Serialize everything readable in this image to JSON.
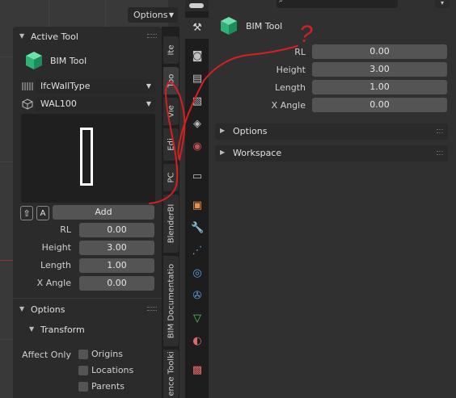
{
  "viewport": {
    "options_label": "Options"
  },
  "npanel": {
    "active_tool": {
      "header": "Active Tool",
      "tool_name": "BIM Tool",
      "type_dropdown": "IfcWallType",
      "element_dropdown": "WAL100",
      "add_label": "Add",
      "add_arrow_glyph": "⇧",
      "add_a_glyph": "A",
      "fields": [
        {
          "label": "RL",
          "value": "0.00"
        },
        {
          "label": "Height",
          "value": "3.00"
        },
        {
          "label": "Length",
          "value": "1.00"
        },
        {
          "label": "X Angle",
          "value": "0.00"
        }
      ]
    },
    "options": {
      "header": "Options",
      "transform_header": "Transform",
      "affect_only_label": "Affect Only",
      "checkboxes": [
        "Origins",
        "Locations",
        "Parents"
      ]
    }
  },
  "tabs": [
    {
      "label": "Ite",
      "active": false
    },
    {
      "label": "Too",
      "active": true
    },
    {
      "label": "Vie",
      "active": false
    },
    {
      "label": "Edi",
      "active": false
    },
    {
      "label": "PC",
      "active": false
    },
    {
      "label": "BlenderBI",
      "active": false
    },
    {
      "label": "BIM Documentatio",
      "active": false
    },
    {
      "label": "ence Toolki",
      "active": false
    }
  ],
  "properties": {
    "tool_name": "BIM Tool",
    "fields": [
      {
        "label": "RL",
        "value": "0.00"
      },
      {
        "label": "Height",
        "value": "3.00"
      },
      {
        "label": "Length",
        "value": "1.00"
      },
      {
        "label": "X Angle",
        "value": "0.00"
      }
    ],
    "panels": [
      "Options",
      "Workspace"
    ],
    "annotation_mark": "?"
  },
  "colors": {
    "accent_green": "#34c98a",
    "annotation_red": "#d42020",
    "field_bg": "#545454"
  }
}
